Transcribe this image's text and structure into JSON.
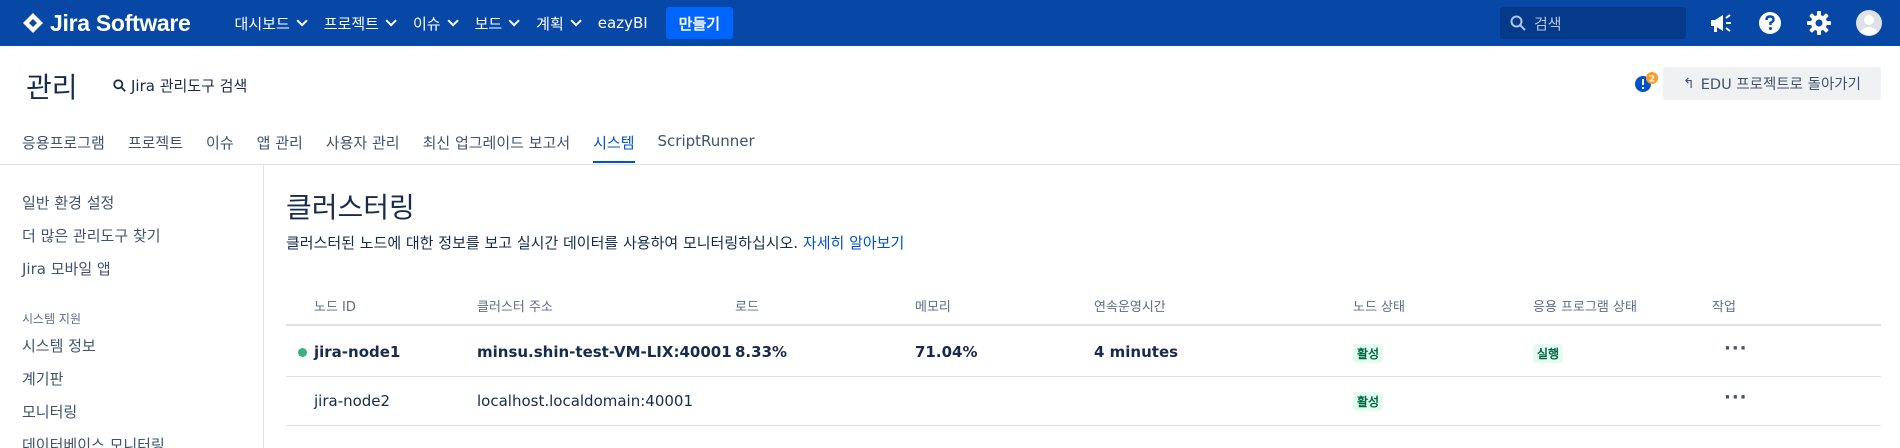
{
  "topnav": {
    "logo_text": "Jira Software",
    "menu": [
      {
        "label": "대시보드"
      },
      {
        "label": "프로젝트"
      },
      {
        "label": "이슈"
      },
      {
        "label": "보드"
      },
      {
        "label": "계획"
      }
    ],
    "eazybi": "eazyBI",
    "create": "만들기",
    "search_placeholder": "검색",
    "colors": {
      "bar": "#0747a6",
      "create": "#0065ff"
    }
  },
  "header": {
    "title": "관리",
    "admin_search": "Jira 관리도구 검색",
    "notification_count": "2",
    "back_button": "EDU 프로젝트로 돌아가기"
  },
  "tabs": [
    {
      "label": "응용프로그램"
    },
    {
      "label": "프로젝트"
    },
    {
      "label": "이슈"
    },
    {
      "label": "앱 관리"
    },
    {
      "label": "사용자 관리"
    },
    {
      "label": "최신 업그레이드 보고서"
    },
    {
      "label": "시스템",
      "active": true
    },
    {
      "label": "ScriptRunner"
    }
  ],
  "sidebar": {
    "links_top": [
      "일반 환경 설정",
      "더 많은 관리도구 찾기",
      "Jira 모바일 앱"
    ],
    "heading": "시스템 지원",
    "links_support": [
      "시스템 정보",
      "계기판",
      "모니터링",
      "데이터베이스 모니터링"
    ]
  },
  "main": {
    "title": "클러스터링",
    "description": "클러스터된 노드에 대한 정보를 보고 실시간 데이터를 사용하여 모니터링하십시오.",
    "learn_more": "자세히 알아보기",
    "columns": [
      "노드 ID",
      "클러스터 주소",
      "로드",
      "메모리",
      "연속운영시간",
      "노드 상태",
      "응용 프로그램 상태",
      "작업"
    ],
    "rows": [
      {
        "node_id": "jira-node1",
        "address": "minsu.shin-test-VM-LIX:40001",
        "load": "8.33%",
        "memory": "71.04%",
        "uptime": "4 minutes",
        "node_status": "활성",
        "app_status": "실행",
        "current": true
      },
      {
        "node_id": "jira-node2",
        "address": "localhost.localdomain:40001",
        "load": "",
        "memory": "",
        "uptime": "",
        "node_status": "활성",
        "app_status": "",
        "current": false
      }
    ]
  }
}
